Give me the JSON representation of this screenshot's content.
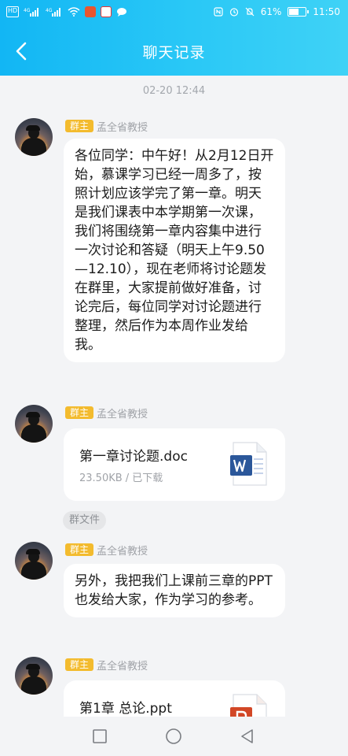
{
  "status_bar": {
    "hd_label": "HD",
    "signal1_label": "4G",
    "signal2_label": "4G",
    "battery_text": "61%",
    "time": "11:50"
  },
  "header": {
    "title": "聊天记录",
    "back_icon": "chevron-left-icon"
  },
  "colors": {
    "header_gradient_start": "#12b6f4",
    "header_gradient_end": "#3fd2f6",
    "role_badge": "#f3bb2e",
    "word_blue": "#2b579a",
    "ppt_orange": "#d24726"
  },
  "chat": {
    "timestamp": "02-20 12:44",
    "messages": [
      {
        "role": "群主",
        "sender": "孟全省教授",
        "type": "text",
        "text": "各位同学：中午好！从2月12日开始，慕课学习已经一周多了，按照计划应该学完了第一章。明天是我们课表中本学期第一次课，我们将围绕第一章内容集中进行一次讨论和答疑（明天上午9.50—12.10），现在老师将讨论题发在群里，大家提前做好准备，讨论完后，每位同学对讨论题进行整理，然后作为本周作业发给我。"
      },
      {
        "role": "群主",
        "sender": "孟全省教授",
        "type": "file",
        "file_name": "第一章讨论题.doc",
        "file_meta": "23.50KB / 已下载",
        "file_icon": "word-doc-icon"
      },
      {
        "role": "群主",
        "sender": "孟全省教授",
        "type": "text",
        "text": "另外，我把我们上课前三章的PPT也发给大家，作为学习的参考。"
      },
      {
        "role": "群主",
        "sender": "孟全省教授",
        "type": "file",
        "file_name": "第1章 总论.ppt",
        "file_icon": "powerpoint-icon"
      }
    ],
    "group_file_tag": "群文件"
  },
  "nav": {
    "recent_icon": "square-icon",
    "home_icon": "circle-icon",
    "back_icon": "triangle-back-icon"
  }
}
